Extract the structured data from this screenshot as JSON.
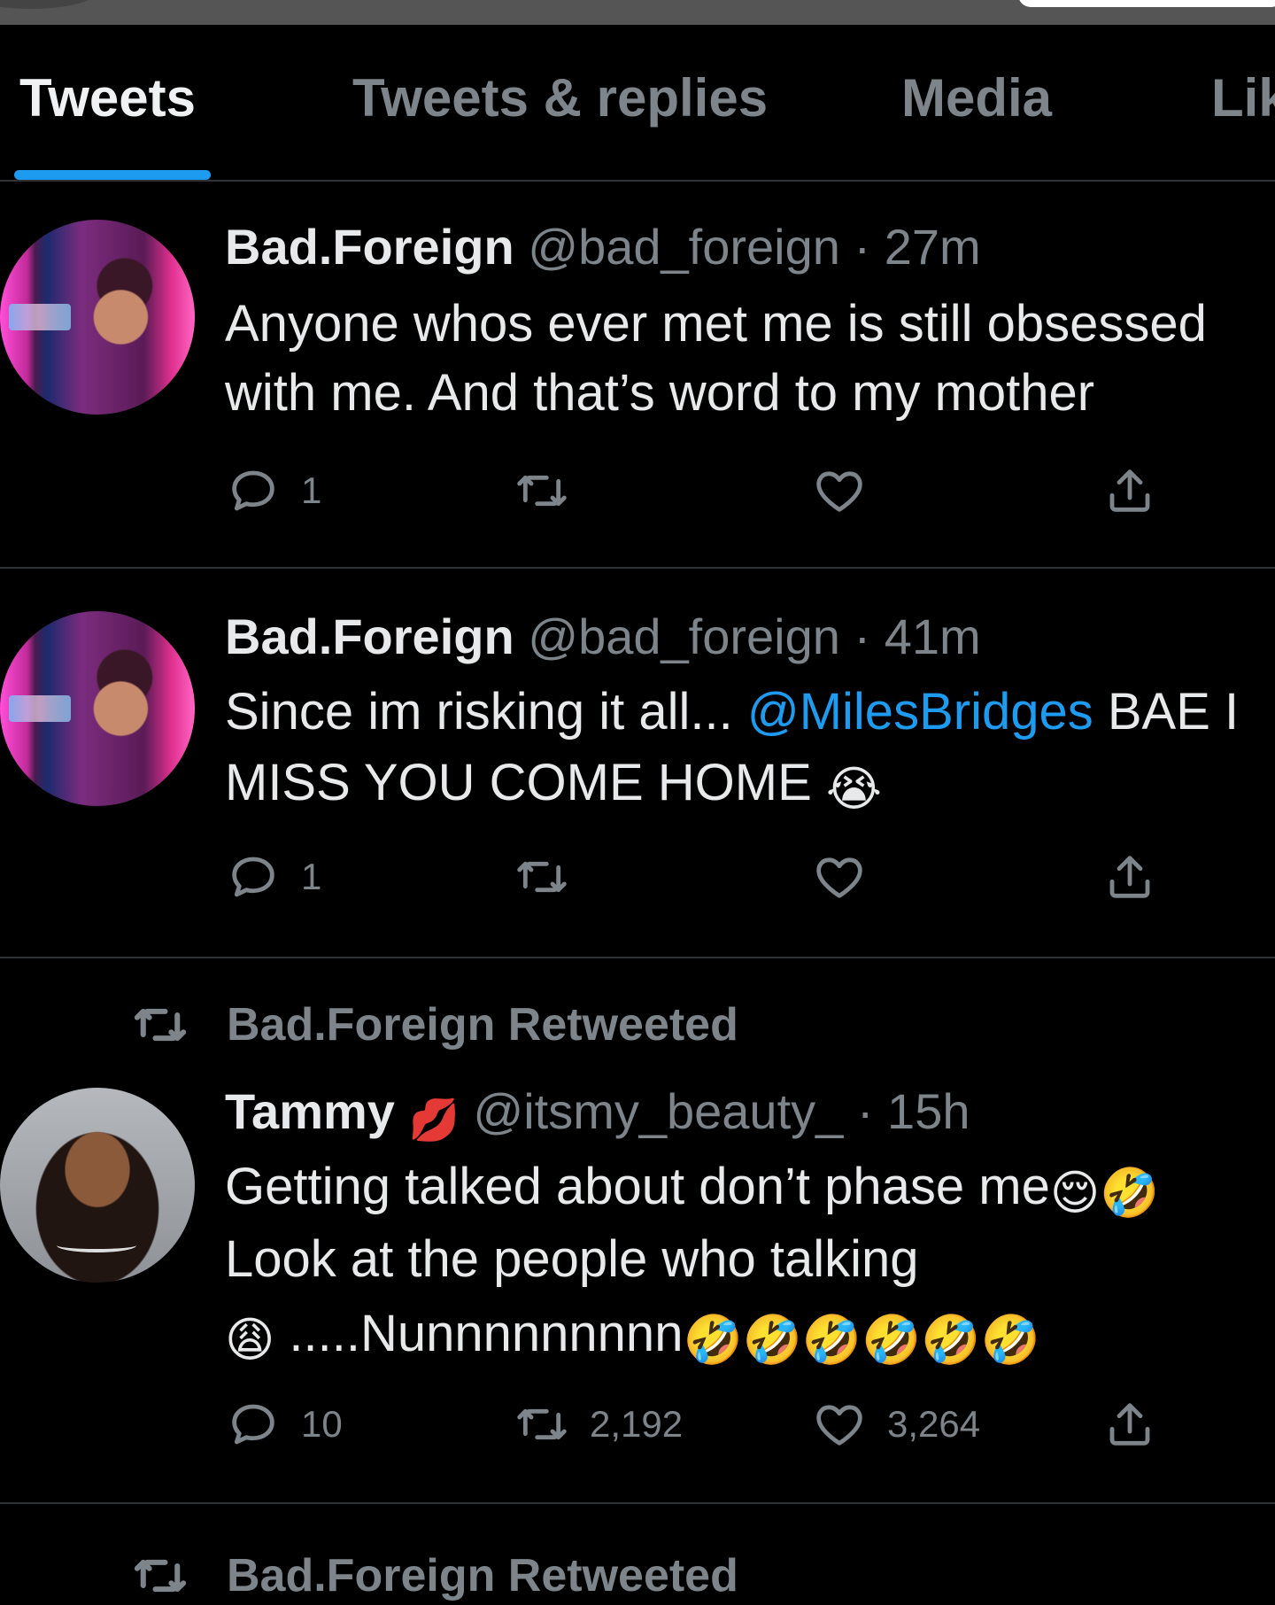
{
  "tabs": [
    {
      "label": "Tweets",
      "active": true
    },
    {
      "label": "Tweets & replies",
      "active": false
    },
    {
      "label": "Media",
      "active": false
    },
    {
      "label": "Lik",
      "active": false
    }
  ],
  "tweets": [
    {
      "name": "Bad.Foreign",
      "handle": "@bad_foreign",
      "time": "27m",
      "line1": "Anyone whos ever met me is still obsessed",
      "line2": "with me. And that’s word to my mother",
      "replies": "1",
      "retweets": "",
      "likes": ""
    },
    {
      "name": "Bad.Foreign",
      "handle": "@bad_foreign",
      "time": "41m",
      "line1_pre": "Since im risking it all...",
      "mention": "@MilesBridges",
      "line1_post": "BAE I",
      "line2": "MISS YOU COME HOME",
      "line2_emoji": "😭",
      "replies": "1",
      "retweets": "",
      "likes": ""
    },
    {
      "retweeted_by": "Bad.Foreign Retweeted",
      "name": "Tammy",
      "name_emoji": "💋",
      "handle": "@itsmy_beauty_",
      "time": "15h",
      "line1": "Getting talked about don’t phase me",
      "line1_emoji": "😌🤣",
      "line2": "Look at the people who talking",
      "line3_emoji_a": "😩",
      "line3_text": ".....Nunnnnnnnnn",
      "line3_emoji_b": "🤣🤣🤣🤣🤣🤣",
      "replies": "10",
      "retweets": "2,192",
      "likes": "3,264"
    }
  ],
  "partial_retweet_label": "Bad.Foreign Retweeted",
  "colors": {
    "accent": "#1d9bf0",
    "text_primary": "#e7e9ea",
    "text_secondary": "#7d848a",
    "background": "#000000",
    "divider": "#2f3336"
  },
  "icons": [
    "reply-icon",
    "retweet-icon",
    "like-icon",
    "share-icon"
  ]
}
